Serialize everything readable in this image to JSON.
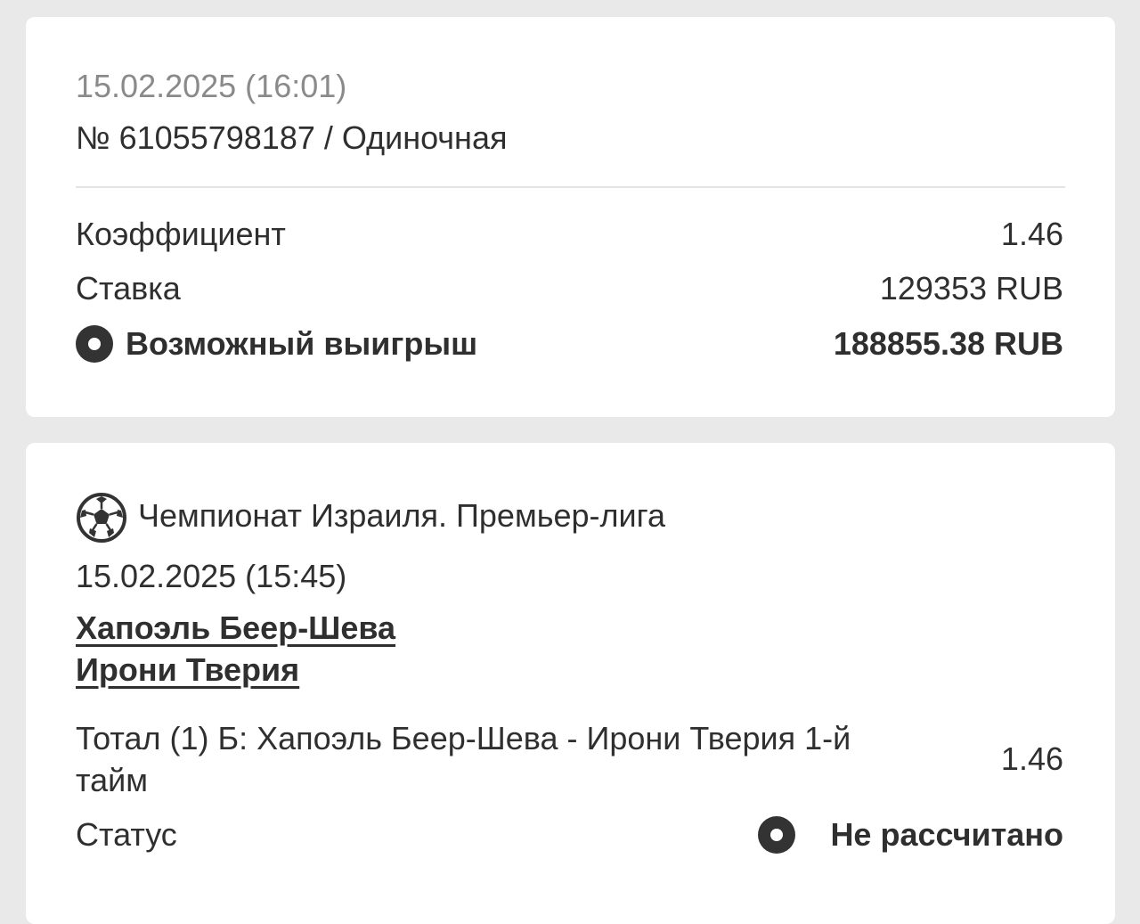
{
  "summary": {
    "datetime": "15.02.2025 (16:01)",
    "bet_id": "№ 61055798187 / Одиночная",
    "rows": {
      "coef_label": "Коэффициент",
      "coef_value": "1.46",
      "stake_label": "Ставка",
      "stake_value": "129353 RUB",
      "win_label": "Возможный выигрыш",
      "win_value": "188855.38 RUB"
    }
  },
  "event": {
    "league": "Чемпионат Израиля. Премьер-лига",
    "league_icon": "soccer-ball-icon",
    "datetime": "15.02.2025 (15:45)",
    "team_home": "Хапоэль Беер-Шева",
    "team_away": "Ирони Тверия",
    "market_line1": "Тотал (1) Б: Хапоэль Беер-Шева - Ирони Тверия 1-й",
    "market_line2": "тайм",
    "market_coef": "1.46",
    "status_label": "Статус",
    "status_value": "Не рассчитано"
  },
  "colors": {
    "background": "#e9e9e9",
    "card": "#ffffff",
    "text": "#2f2f2f",
    "muted": "#8a8a8a",
    "icon": "#333333"
  }
}
